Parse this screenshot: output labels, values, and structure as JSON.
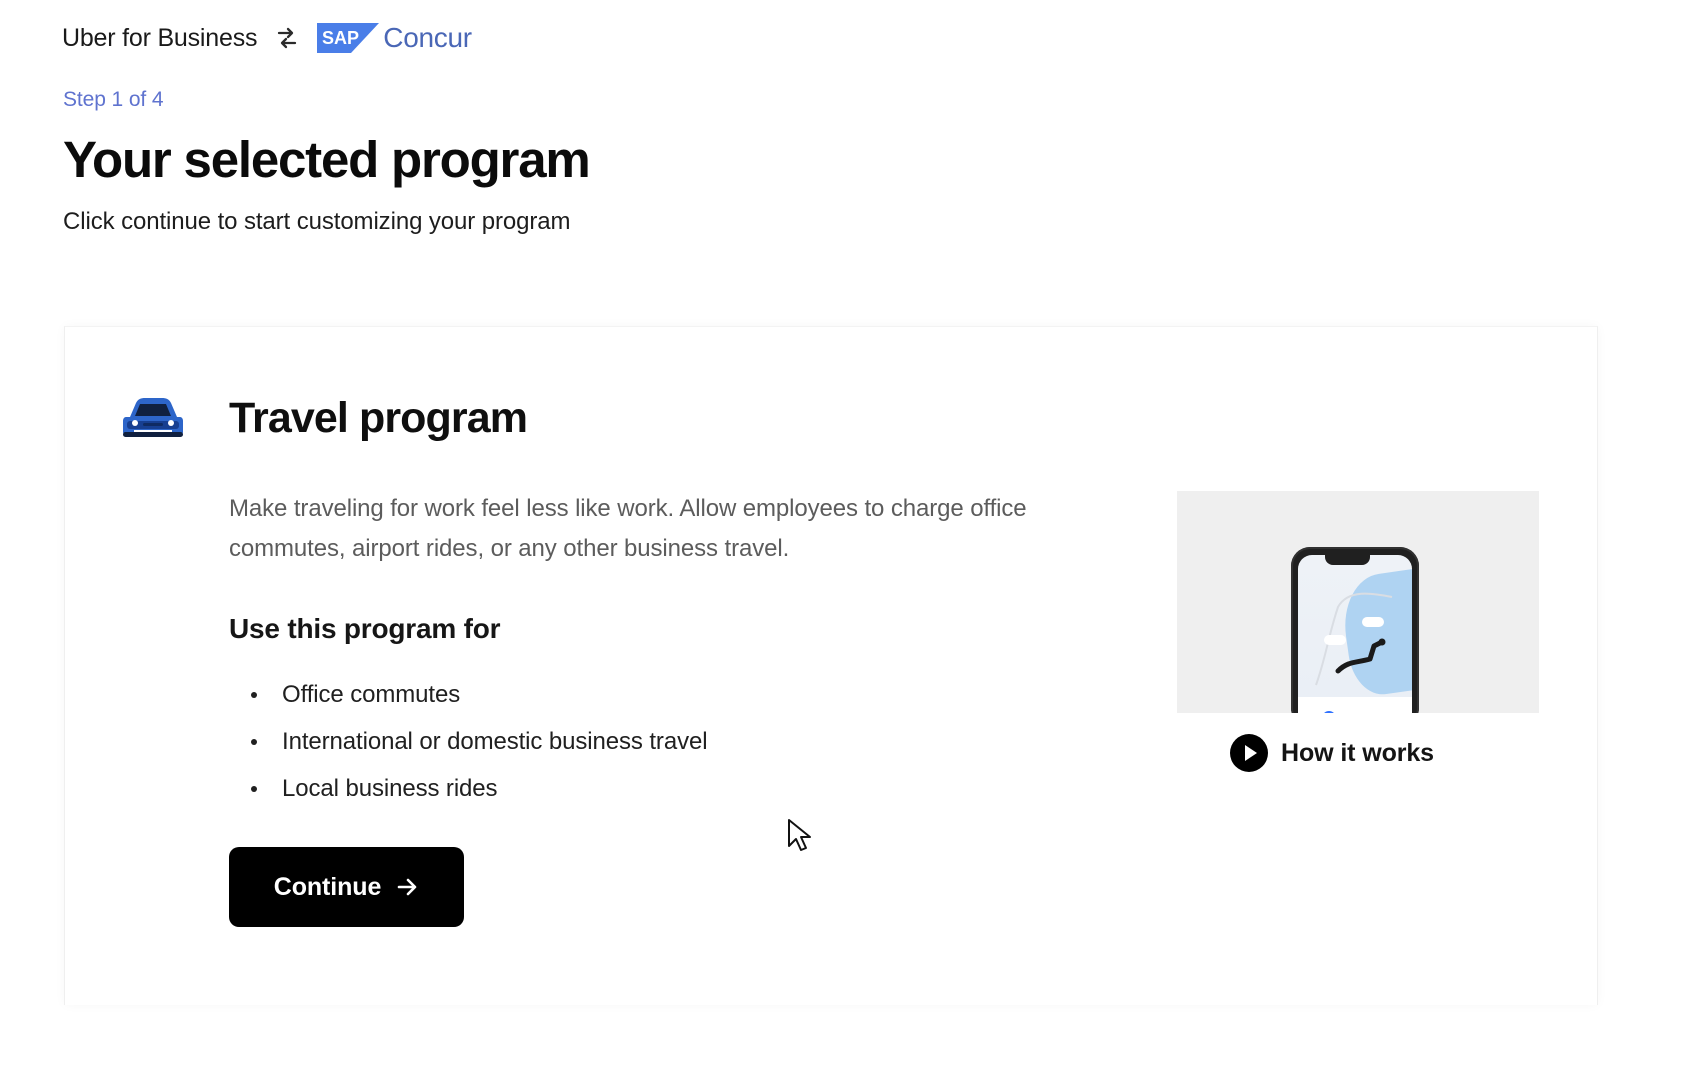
{
  "header": {
    "brand": "Uber for Business",
    "partner": {
      "badge": "SAP",
      "name": "Concur"
    }
  },
  "progress": {
    "step_label": "Step 1 of 4"
  },
  "page": {
    "title": "Your selected program",
    "subtitle": "Click continue to start customizing your program"
  },
  "program": {
    "icon": "car-icon",
    "title": "Travel program",
    "description": "Make traveling for work feel less like work. Allow employees to charge office commutes, airport rides, or any other business travel.",
    "use_heading": "Use this program for",
    "uses": [
      "Office commutes",
      "International or domestic business travel",
      "Local business rides"
    ],
    "continue_label": "Continue",
    "video_link": "How it works"
  },
  "icons": {
    "swap": "swap-icon",
    "arrow": "arrow-right-icon",
    "play": "play-icon",
    "cursor": "mouse-pointer-icon"
  },
  "colors": {
    "step": "#5f73cf",
    "concur": "#4a67b6",
    "button": "#000000",
    "car": "#2d65c9"
  }
}
